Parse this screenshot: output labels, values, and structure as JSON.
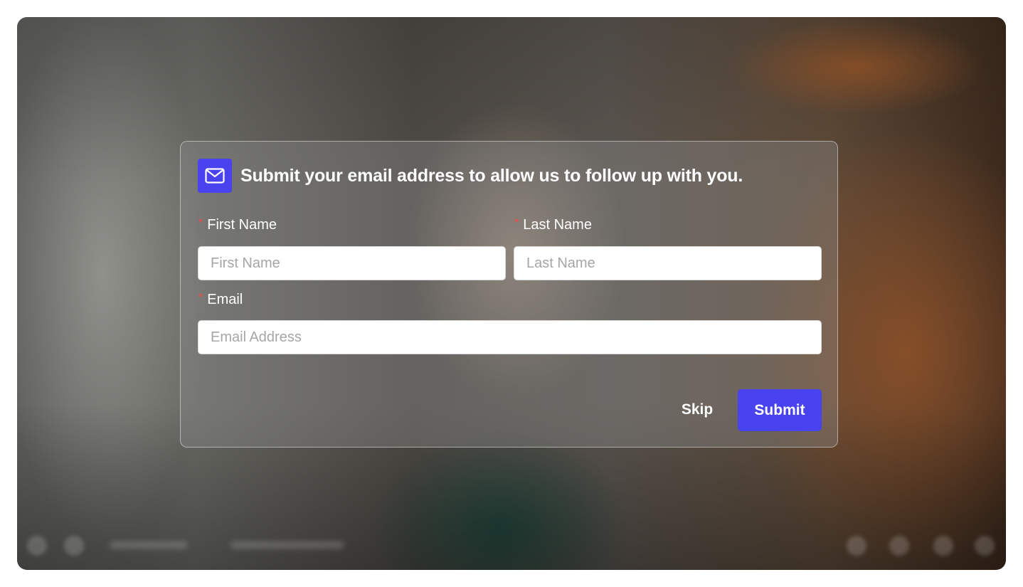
{
  "dialog": {
    "title": "Submit your email address to allow us to follow up with you.",
    "icon": "mail-icon",
    "accent_color": "#4842ef"
  },
  "form": {
    "first_name": {
      "required_mark": "*",
      "label": "First Name",
      "placeholder": "First Name",
      "value": ""
    },
    "last_name": {
      "required_mark": "*",
      "label": "Last Name",
      "placeholder": "Last Name",
      "value": ""
    },
    "email": {
      "required_mark": "*",
      "label": "Email",
      "placeholder": "Email Address",
      "value": ""
    }
  },
  "actions": {
    "skip_label": "Skip",
    "submit_label": "Submit"
  }
}
